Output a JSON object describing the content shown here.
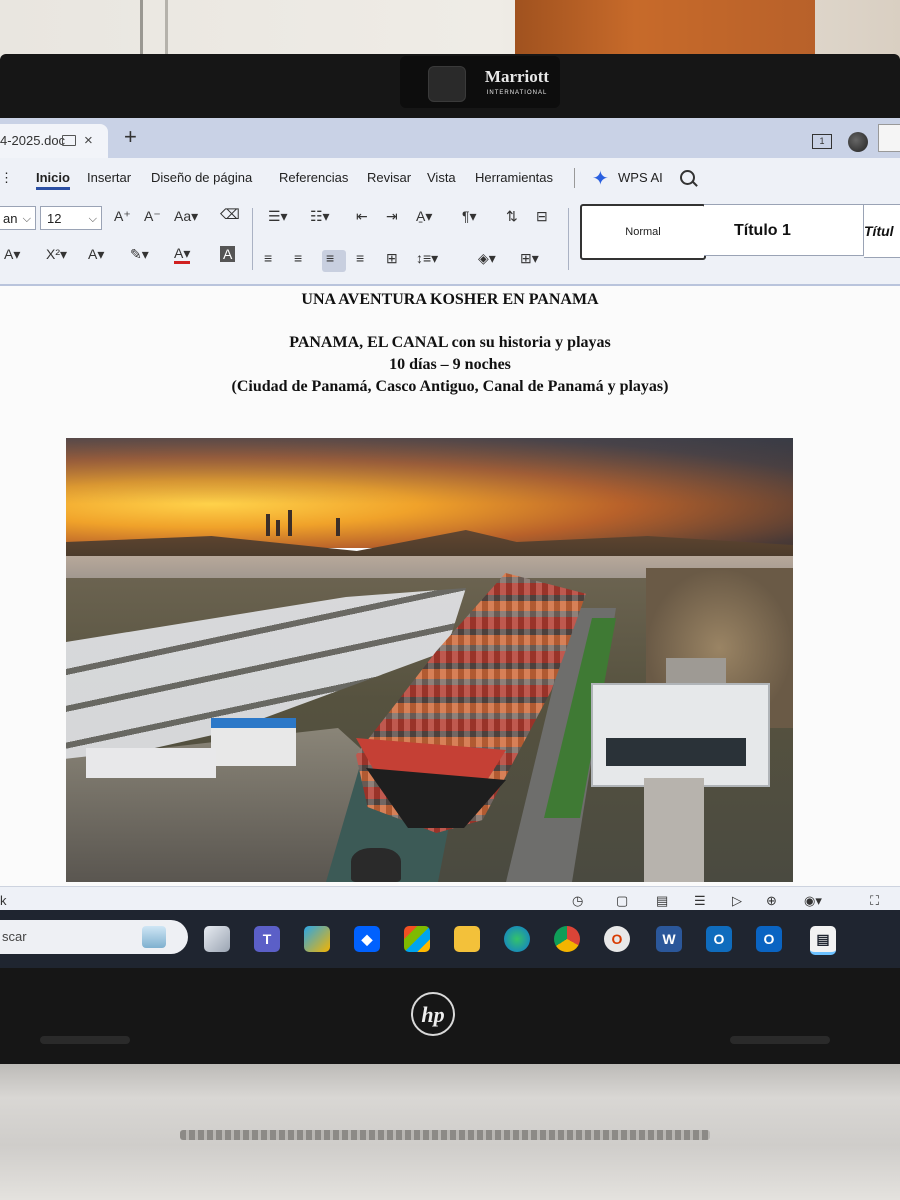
{
  "window": {
    "tab_title": "4-2025.doc",
    "tab_close": "×",
    "new_tab": "+",
    "window_badge": "1"
  },
  "laptop": {
    "webcam_brand": "Marriott",
    "webcam_brand_sub": "INTERNATIONAL",
    "maker_logo": "hp"
  },
  "menu": {
    "items": [
      "Inicio",
      "Insertar",
      "Diseño de página",
      "Referencias",
      "Revisar",
      "Vista",
      "Herramientas"
    ],
    "active_index": 0,
    "ai_label": "WPS AI"
  },
  "ribbon": {
    "font_name": "an",
    "font_size": "12",
    "styles": [
      "Normal",
      "Título 1",
      "Títul"
    ]
  },
  "document": {
    "line1": "UNA AVENTURA KOSHER EN PANAMA",
    "line2": "PANAMA, EL CANAL con su historia y playas",
    "line3": "10 días – 9 noches",
    "line4": "(Ciudad de Panamá, Casco Antiguo, Canal de Panamá y playas)"
  },
  "statusbar": {
    "left_text": "k"
  },
  "taskbar": {
    "search_placeholder": "scar",
    "icons": [
      "task-view-icon",
      "teams-icon",
      "photos-icon",
      "dropbox-icon",
      "store-icon",
      "file-explorer-icon",
      "edge-icon",
      "chrome-icon",
      "office-icon",
      "word-icon",
      "outlook-icon",
      "outlook-new-icon",
      "document-app-icon"
    ]
  },
  "colors": {
    "accent": "#2b4fa3",
    "taskbar_bg": "#1f2530",
    "ribbon_bg": "#eef1f7"
  }
}
